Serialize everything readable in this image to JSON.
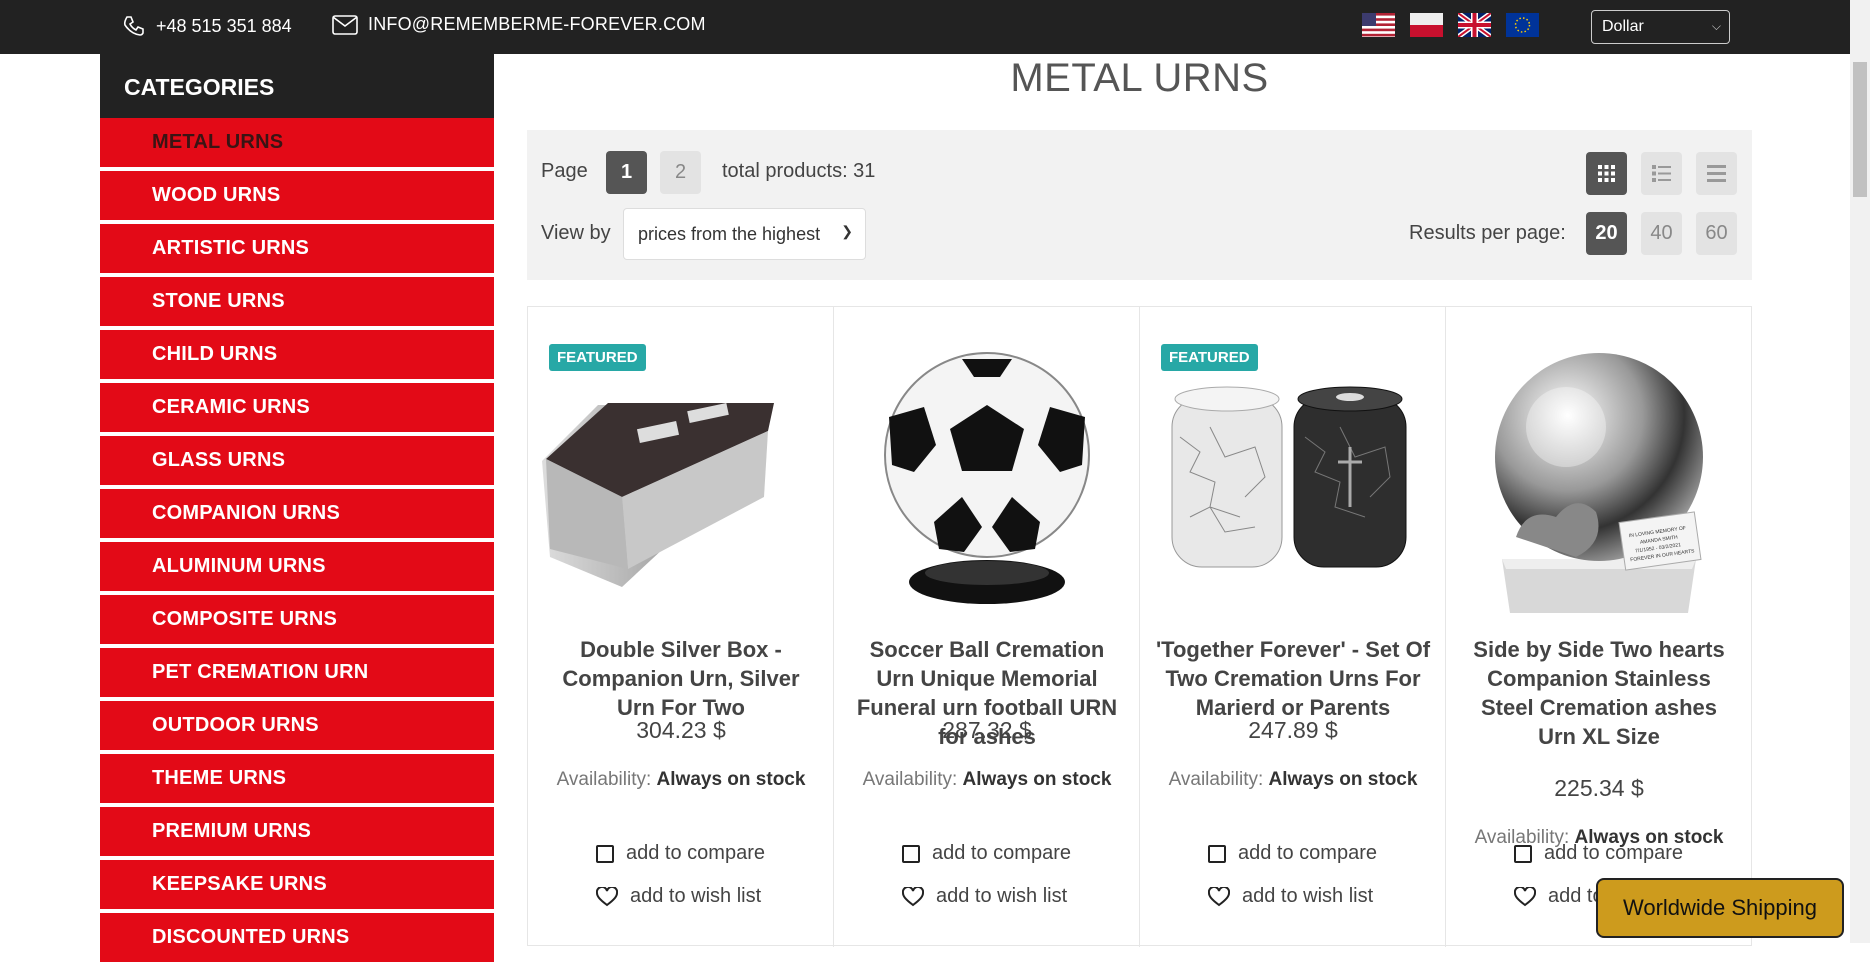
{
  "topbar": {
    "phone": "+48 515 351 884",
    "email": "INFO@REMEMBERME-FOREVER.COM",
    "currency": "Dollar"
  },
  "sidebar": {
    "title": "CATEGORIES",
    "items": [
      {
        "label": "METAL URNS"
      },
      {
        "label": "WOOD URNS"
      },
      {
        "label": "ARTISTIC URNS"
      },
      {
        "label": "STONE URNS"
      },
      {
        "label": "CHILD URNS"
      },
      {
        "label": "CERAMIC URNS"
      },
      {
        "label": "GLASS URNS"
      },
      {
        "label": "COMPANION URNS"
      },
      {
        "label": "ALUMINUM URNS"
      },
      {
        "label": "COMPOSITE URNS"
      },
      {
        "label": "PET CREMATION URN"
      },
      {
        "label": "OUTDOOR URNS"
      },
      {
        "label": "THEME URNS"
      },
      {
        "label": "PREMIUM URNS"
      },
      {
        "label": "KEEPSAKE URNS"
      },
      {
        "label": "DISCOUNTED URNS"
      }
    ]
  },
  "main": {
    "title": "METAL URNS",
    "page_label": "Page",
    "pages": [
      "1",
      "2"
    ],
    "total": "total products: 31",
    "view_by_label": "View by",
    "sort_value": "prices from the highest",
    "results_label": "Results per page:",
    "per_page": [
      "20",
      "40",
      "60"
    ]
  },
  "products": [
    {
      "badge": "FEATURED",
      "name": "Double Silver Box - Companion Urn, Silver Urn For Two",
      "price": "304.23 $",
      "avail_label": "Availability:",
      "avail_value": "Always on stock",
      "compare": "add to compare",
      "wish": "add to wish list"
    },
    {
      "badge": "",
      "name": "Soccer Ball Cremation Urn Unique Memorial Funeral urn football URN for ashes",
      "price": "287.32 $",
      "avail_label": "Availability:",
      "avail_value": "Always on stock",
      "compare": "add to compare",
      "wish": "add to wish list"
    },
    {
      "badge": "FEATURED",
      "name": "'Together Forever' - Set Of Two Cremation Urns For Marierd or Parents",
      "price": "247.89 $",
      "avail_label": "Availability:",
      "avail_value": "Always on stock",
      "compare": "add to compare",
      "wish": "add to wish list"
    },
    {
      "badge": "",
      "name": "Side by Side Two hearts Companion Stainless Steel Cremation ashes Urn XL Size",
      "price": "225.34 $",
      "avail_label": "Availability:",
      "avail_value": "Always on stock",
      "compare": "add to compare",
      "wish": "add to wish list"
    }
  ],
  "plaque": {
    "line1": "IN LOVING MEMORY OF",
    "line2": "AMANDA SMITH",
    "line3": "7/1/1952 - 03/2/2021",
    "line4": "FOREVER IN OUR HEARTS"
  },
  "shipping_button": "Worldwide Shipping",
  "colors": {
    "category_red": "#e30a17",
    "dark_bar": "#222222",
    "featured_teal": "#27a8a6",
    "shipping_gold": "#cd9b1d"
  }
}
